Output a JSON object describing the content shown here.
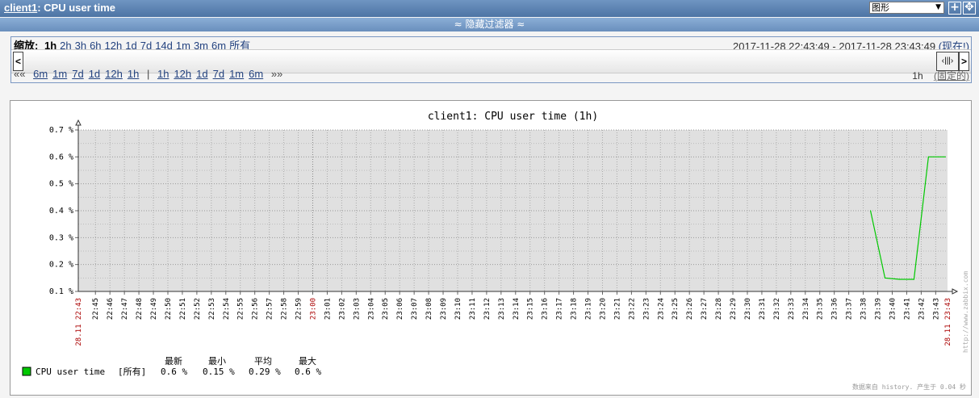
{
  "header": {
    "host_link": "client1",
    "title_rest": ": CPU user time",
    "select_value": "图形"
  },
  "filter_bar": {
    "label": "≈ 隐藏过滤器 ≈"
  },
  "zoom": {
    "label": "缩放:",
    "options": [
      "1h",
      "2h",
      "3h",
      "6h",
      "12h",
      "1d",
      "7d",
      "14d",
      "1m",
      "3m",
      "6m",
      "所有"
    ],
    "active": "1h"
  },
  "period": {
    "text": "2017-11-28 22:43:49  -  2017-11-28 23:43:49",
    "now_label": "(现在!)"
  },
  "nav": {
    "back_marker": "««",
    "back": [
      "6m",
      "1m",
      "7d",
      "1d",
      "12h",
      "1h"
    ],
    "separator": "|",
    "forward": [
      "1h",
      "12h",
      "1d",
      "7d",
      "1m",
      "6m"
    ],
    "forward_marker": "»»",
    "length": "1h",
    "fixed_label": "(固定的)"
  },
  "chart_data": {
    "type": "line",
    "title": "client1: CPU user time (1h)",
    "y_ticks": [
      "0.7 %",
      "0.6 %",
      "0.5 %",
      "0.4 %",
      "0.3 %",
      "0.2 %",
      "0.1 %"
    ],
    "ylim": [
      0.1,
      0.7
    ],
    "x_start_label": "28.11 22:43",
    "x_end_label": "28.11 23:43",
    "x_tick_labels": [
      "22:45",
      "22:46",
      "22:47",
      "22:48",
      "22:49",
      "22:50",
      "22:51",
      "22:52",
      "22:53",
      "22:54",
      "22:55",
      "22:56",
      "22:57",
      "22:58",
      "22:59",
      "23:00",
      "23:01",
      "23:02",
      "23:03",
      "23:04",
      "23:05",
      "23:06",
      "23:07",
      "23:08",
      "23:09",
      "23:10",
      "23:11",
      "23:12",
      "23:13",
      "23:14",
      "23:15",
      "23:16",
      "23:17",
      "23:18",
      "23:19",
      "23:20",
      "23:21",
      "23:22",
      "23:23",
      "23:24",
      "23:25",
      "23:26",
      "23:27",
      "23:28",
      "23:29",
      "23:30",
      "23:31",
      "23:32",
      "23:33",
      "23:34",
      "23:35",
      "23:36",
      "23:37",
      "23:38",
      "23:39",
      "23:40",
      "23:41",
      "23:42",
      "23:43"
    ],
    "series": [
      {
        "name": "CPU user time",
        "color": "#00c800",
        "points": [
          {
            "x": "23:38:30",
            "y": 0.4
          },
          {
            "x": "23:39:30",
            "y": 0.15
          },
          {
            "x": "23:40:30",
            "y": 0.145
          },
          {
            "x": "23:41:30",
            "y": 0.145
          },
          {
            "x": "23:42:30",
            "y": 0.6
          },
          {
            "x": "23:43:40",
            "y": 0.6
          }
        ]
      }
    ],
    "legend": {
      "headers": [
        "最新",
        "最小",
        "平均",
        "最大"
      ],
      "item_label": "CPU user time",
      "item_scope": "[所有]",
      "values": [
        "0.6 %",
        "0.15 %",
        "0.29 %",
        "0.6 %"
      ]
    },
    "side_watermark": "http://www.zabbix.com",
    "footer_note": "数据来自 history. 产生于 0.04 秒",
    "grid": true
  }
}
